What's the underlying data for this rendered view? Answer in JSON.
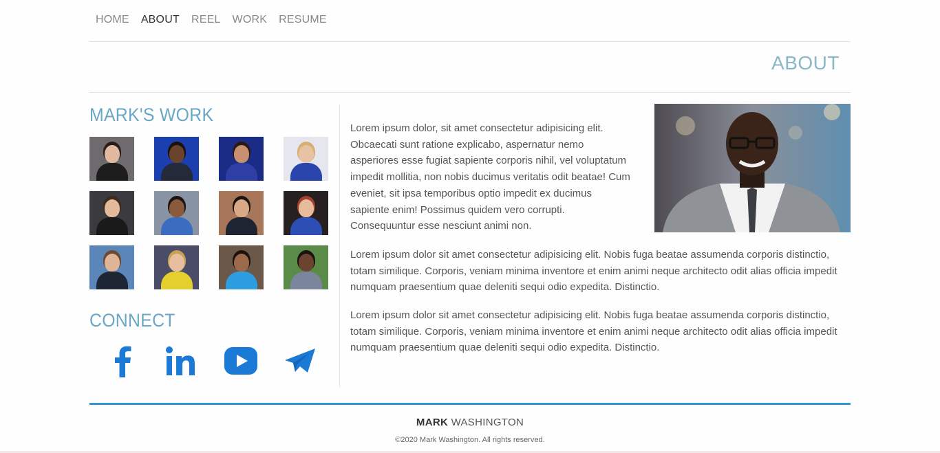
{
  "nav": {
    "items": [
      {
        "label": "HOME"
      },
      {
        "label": "ABOUT"
      },
      {
        "label": "REEL"
      },
      {
        "label": "WORK"
      },
      {
        "label": "RESUME"
      }
    ],
    "active": "ABOUT"
  },
  "page_heading": "ABOUT",
  "work": {
    "title": "MARK'S WORK",
    "thumbnails": [
      {
        "bg": "#6e6a6e",
        "skin": "#e0b9a0",
        "outfit": "#1d1d1d",
        "hair": "#2a1c17"
      },
      {
        "bg": "#1c3fb0",
        "skin": "#6a432c",
        "outfit": "#252a3a",
        "hair": "#1a120e"
      },
      {
        "bg": "#1a2c85",
        "skin": "#c79070",
        "outfit": "#2d3fa5",
        "hair": "#2b1a14"
      },
      {
        "bg": "#e6e7ee",
        "skin": "#e8c2a5",
        "outfit": "#2a46ac",
        "hair": "#d6b070"
      },
      {
        "bg": "#3a3a3f",
        "skin": "#e3b99b",
        "outfit": "#1a1a1a",
        "hair": "#3d2b1e"
      },
      {
        "bg": "#8893a3",
        "skin": "#8a5a3d",
        "outfit": "#3a6cc0",
        "hair": "#1c1411"
      },
      {
        "bg": "#a87658",
        "skin": "#d9a887",
        "outfit": "#1e2530",
        "hair": "#1e140e"
      },
      {
        "bg": "#262020",
        "skin": "#e7bc9c",
        "outfit": "#2d4fb5",
        "hair": "#a4412c"
      },
      {
        "bg": "#5a86b9",
        "skin": "#e0b597",
        "outfit": "#1e2633",
        "hair": "#6b4a30"
      },
      {
        "bg": "#4b4d68",
        "skin": "#e7bea0",
        "outfit": "#e4cf2f",
        "hair": "#c8a154"
      },
      {
        "bg": "#6b5848",
        "skin": "#9a6a4b",
        "outfit": "#2d9de0",
        "hair": "#1b120e"
      },
      {
        "bg": "#5a8b48",
        "skin": "#6b4430",
        "outfit": "#7b869c",
        "hair": "#1a120e"
      }
    ]
  },
  "connect": {
    "title": "CONNECT",
    "icons": [
      "facebook-icon",
      "linkedin-icon",
      "youtube-icon",
      "telegram-icon"
    ],
    "color": "#1c7ad7"
  },
  "about": {
    "paragraphs": [
      "Lorem ipsum dolor, sit amet consectetur adipisicing elit. Obcaecati sunt ratione explicabo, aspernatur nemo asperiores esse fugiat sapiente corporis nihil, vel voluptatum impedit mollitia, non nobis ducimus veritatis odit beatae! Cum eveniet, sit ipsa temporibus optio impedit ex ducimus sapiente enim! Possimus quidem vero corrupti. Consequuntur esse nesciunt animi non.",
      "Lorem ipsum dolor sit amet consectetur adipisicing elit. Nobis fuga beatae assumenda corporis distinctio, totam similique. Corporis, veniam minima inventore et enim animi neque architecto odit alias officia impedit numquam praesentium quae deleniti sequi odio expedita. Distinctio.",
      "Lorem ipsum dolor sit amet consectetur adipisicing elit. Nobis fuga beatae assumenda corporis distinctio, totam similique. Corporis, veniam minima inventore et enim animi neque architecto odit alias officia impedit numquam praesentium quae deleniti sequi odio expedita. Distinctio."
    ]
  },
  "footer": {
    "name_first": "MARK",
    "name_last": " WASHINGTON",
    "copyright": "©2020 Mark Washington. All rights reserved."
  },
  "colors": {
    "accent": "#2f95d3",
    "heading": "#6aa7c7"
  }
}
